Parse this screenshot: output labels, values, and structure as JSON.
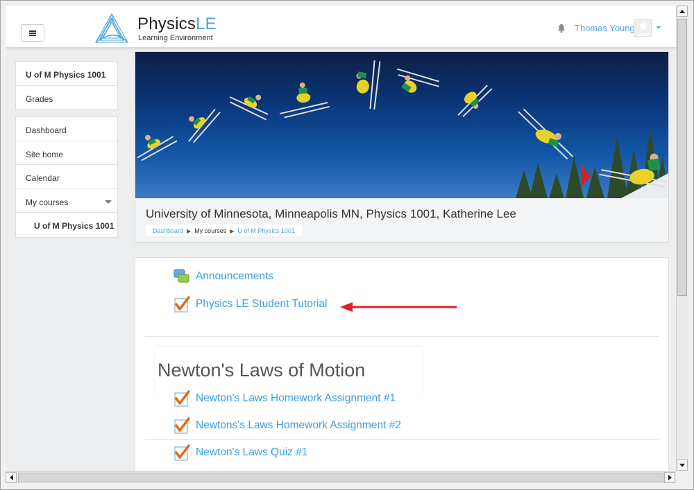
{
  "brand": {
    "name_main": "Physics",
    "name_accent": "LE",
    "subtitle": "Learning Environment",
    "accent_color": "#4aa3df"
  },
  "user": {
    "name": "Thomas Young"
  },
  "icons": {
    "menu": "hamburger-icon",
    "notifications": "bell-icon",
    "user_menu": "chevron-down-icon",
    "forum": "forum-icon",
    "assignment": "assignment-check-icon"
  },
  "sidebar": {
    "course_block": [
      {
        "label": "U of M Physics 1001"
      },
      {
        "label": "Grades"
      }
    ],
    "nav_block": [
      {
        "label": "Dashboard"
      },
      {
        "label": "Site home"
      },
      {
        "label": "Calendar"
      },
      {
        "label": "My courses"
      },
      {
        "label": "U of M Physics 1001"
      }
    ]
  },
  "header": {
    "course_title": "University of Minnesota, Minneapolis MN, Physics 1001, Katherine Lee",
    "breadcrumb": [
      "Dashboard",
      "My courses",
      "U of M Physics 1001"
    ]
  },
  "content": {
    "general_activities": [
      {
        "label": "Announcements"
      },
      {
        "label": "Physics LE Student Tutorial"
      }
    ],
    "section": {
      "title": "Newton's Laws of Motion",
      "activities": [
        {
          "label": "Newton's Laws Homework Assignment #1"
        },
        {
          "label": "Newtons's Laws Homework Assignment #2"
        },
        {
          "label": "Newton's Laws Quiz #1"
        }
      ]
    }
  },
  "annotation": {
    "arrow_color": "#e02020"
  }
}
